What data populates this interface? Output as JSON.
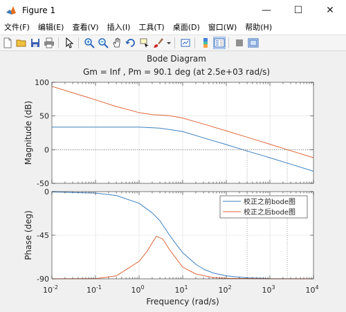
{
  "window": {
    "title": "Figure 1",
    "minimize_glyph": "—",
    "maximize_glyph": "☐",
    "close_glyph": "✕"
  },
  "menu": {
    "items": [
      {
        "label": "文件(F)"
      },
      {
        "label": "编辑(E)"
      },
      {
        "label": "查看(V)"
      },
      {
        "label": "插入(I)"
      },
      {
        "label": "工具(T)"
      },
      {
        "label": "桌面(D)"
      },
      {
        "label": "窗口(W)"
      },
      {
        "label": "帮助(H)"
      }
    ]
  },
  "toolbar": {
    "icons": [
      "new-figure-icon",
      "open-file-icon",
      "save-icon",
      "print-icon",
      "pointer-icon",
      "zoom-in-icon",
      "zoom-out-icon",
      "pan-icon",
      "rotate-3d-icon",
      "data-cursor-icon",
      "brush-icon",
      "brush-dropdown-icon",
      "link-plot-icon",
      "colorbar-icon",
      "legend-icon",
      "hide-plot-tools-icon",
      "show-plot-tools-icon"
    ]
  },
  "plot": {
    "title": "Bode Diagram",
    "subtitle": "Gm = Inf ,  Pm = 90.1 deg (at 2.5e+03 rad/s)",
    "colors": {
      "series1": "#3a80c0",
      "series2": "#e0663a",
      "margin_line": "#555555"
    }
  },
  "chart_data": {
    "type": "line",
    "title": "Bode Diagram",
    "subtitle": "Gm = Inf ,  Pm = 90.1 deg (at 2.5e+03 rad/s)",
    "xlabel": "Frequency  (rad/s)",
    "xscale": "log",
    "xlim": [
      0.01,
      10000
    ],
    "xticks": [
      "10^-2",
      "10^-1",
      "10^0",
      "10^1",
      "10^2",
      "10^3",
      "10^4"
    ],
    "legend": {
      "placement": "top-right",
      "entries": [
        "校正之前bode图",
        "校正之后bode图"
      ]
    },
    "magnitude": {
      "ylabel": "Magnitude (dB)",
      "ylim": [
        -50,
        100
      ],
      "yticks": [
        "100",
        "50",
        "0",
        "-50"
      ],
      "series": [
        {
          "name": "校正之前bode图",
          "x": [
            0.01,
            0.1,
            1,
            3,
            10,
            30,
            100,
            300,
            1000,
            3000,
            10000
          ],
          "y": [
            33.5,
            33.5,
            33.4,
            32,
            27,
            17.5,
            7.5,
            -2,
            -12,
            -21.5,
            -32
          ]
        },
        {
          "name": "校正之后bode图",
          "x": [
            0.01,
            0.1,
            0.3,
            1,
            2,
            3,
            5,
            10,
            30,
            100,
            300,
            1000,
            2500,
            10000
          ],
          "y": [
            94,
            74,
            64,
            55,
            52,
            51.5,
            50.5,
            47,
            38,
            28,
            18.5,
            8,
            0,
            -12
          ]
        }
      ],
      "crossovers": [
        300,
        2500
      ]
    },
    "phase": {
      "ylabel": "Phase (deg)",
      "ylim": [
        -90,
        0
      ],
      "yticks": [
        "0",
        "-45",
        "-90"
      ],
      "series": [
        {
          "name": "校正之前bode图",
          "x": [
            0.01,
            0.1,
            0.3,
            1,
            2,
            3,
            5,
            7,
            10,
            20,
            30,
            50,
            100,
            300,
            1000,
            10000
          ],
          "y": [
            -0.3,
            -1.5,
            -4,
            -12,
            -22,
            -30,
            -45,
            -54,
            -63,
            -75,
            -80,
            -84,
            -87,
            -89,
            -89.8,
            -90
          ]
        },
        {
          "name": "校正之后bode图",
          "x": [
            0.01,
            0.1,
            0.3,
            1,
            1.5,
            2.5,
            3.5,
            5,
            10,
            20,
            50,
            100,
            1000,
            10000
          ],
          "y": [
            -90,
            -89.8,
            -87,
            -72,
            -62,
            -46,
            -49,
            -60,
            -78,
            -85,
            -88.8,
            -89.5,
            -90,
            -90
          ]
        }
      ]
    }
  }
}
